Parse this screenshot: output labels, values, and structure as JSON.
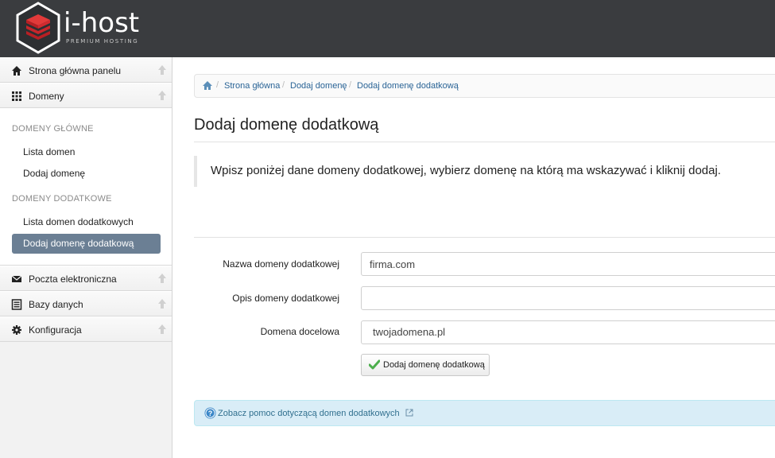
{
  "header": {
    "logo_name": "i-host",
    "logo_tagline": "PREMIUM HOSTING",
    "logo_icon": "stacked-layers-hexagon-logo",
    "background_color": "#3a3c3f"
  },
  "sidebar": {
    "top_items": [
      {
        "label": "Strona główna panelu",
        "icon": "home-icon"
      },
      {
        "label": "Domeny",
        "icon": "grid-icon"
      }
    ],
    "sections": [
      {
        "title": "DOMENY GŁÓWNE",
        "items": [
          "Lista domen",
          "Dodaj domenę"
        ]
      },
      {
        "title": "DOMENY DODATKOWE",
        "items": [
          "Lista domen dodatkowych",
          "Dodaj domenę dodatkową"
        ]
      }
    ],
    "active_item": "Dodaj domenę dodatkową",
    "bottom_items": [
      {
        "label": "Poczta elektroniczna",
        "icon": "envelope-icon"
      },
      {
        "label": "Bazy danych",
        "icon": "list-icon"
      },
      {
        "label": "Konfiguracja",
        "icon": "gear-icon"
      }
    ],
    "active_color": "#6b7f94"
  },
  "breadcrumb": {
    "items": [
      "Strona główna",
      "Dodaj domenę",
      "Dodaj domenę dodatkową"
    ]
  },
  "page": {
    "title": "Dodaj domenę dodatkową",
    "instructions": "Wpisz poniżej dane domeny dodatkowej, wybierz domenę na którą ma wskazywać i kliknij dodaj."
  },
  "form": {
    "domain_name_label": "Nazwa domeny dodatkowej",
    "domain_name_value": "firma.com",
    "description_label": "Opis domeny dodatkowej",
    "description_value": "",
    "target_label": "Domena docelowa",
    "target_value": "twojadomena.pl",
    "submit_label": "Dodaj domenę dodatkową"
  },
  "help": {
    "link_text": "Zobacz pomoc dotyczącą domen dodatkowych",
    "background_color": "#d9edf7"
  }
}
